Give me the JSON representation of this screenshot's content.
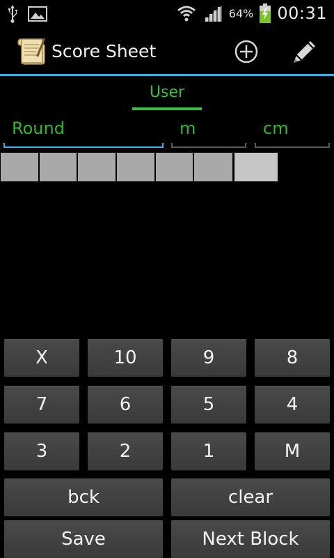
{
  "status_bar": {
    "battery_percent": "64%",
    "time": "00:31"
  },
  "action_bar": {
    "title": "Score Sheet",
    "accent_color": "#33b5e5"
  },
  "tab": {
    "label": "User",
    "color": "#3cbf3c"
  },
  "fields": {
    "round": "Round",
    "m": "m",
    "cm": "cm"
  },
  "score_cells": {
    "count": 7,
    "active_index": 6
  },
  "keypad": {
    "row1": [
      "X",
      "10",
      "9",
      "8"
    ],
    "row2": [
      "7",
      "6",
      "5",
      "4"
    ],
    "row3": [
      "3",
      "2",
      "1",
      "M"
    ],
    "back": "bck",
    "clear": "clear",
    "save": "Save",
    "next_block": "Next Block"
  }
}
